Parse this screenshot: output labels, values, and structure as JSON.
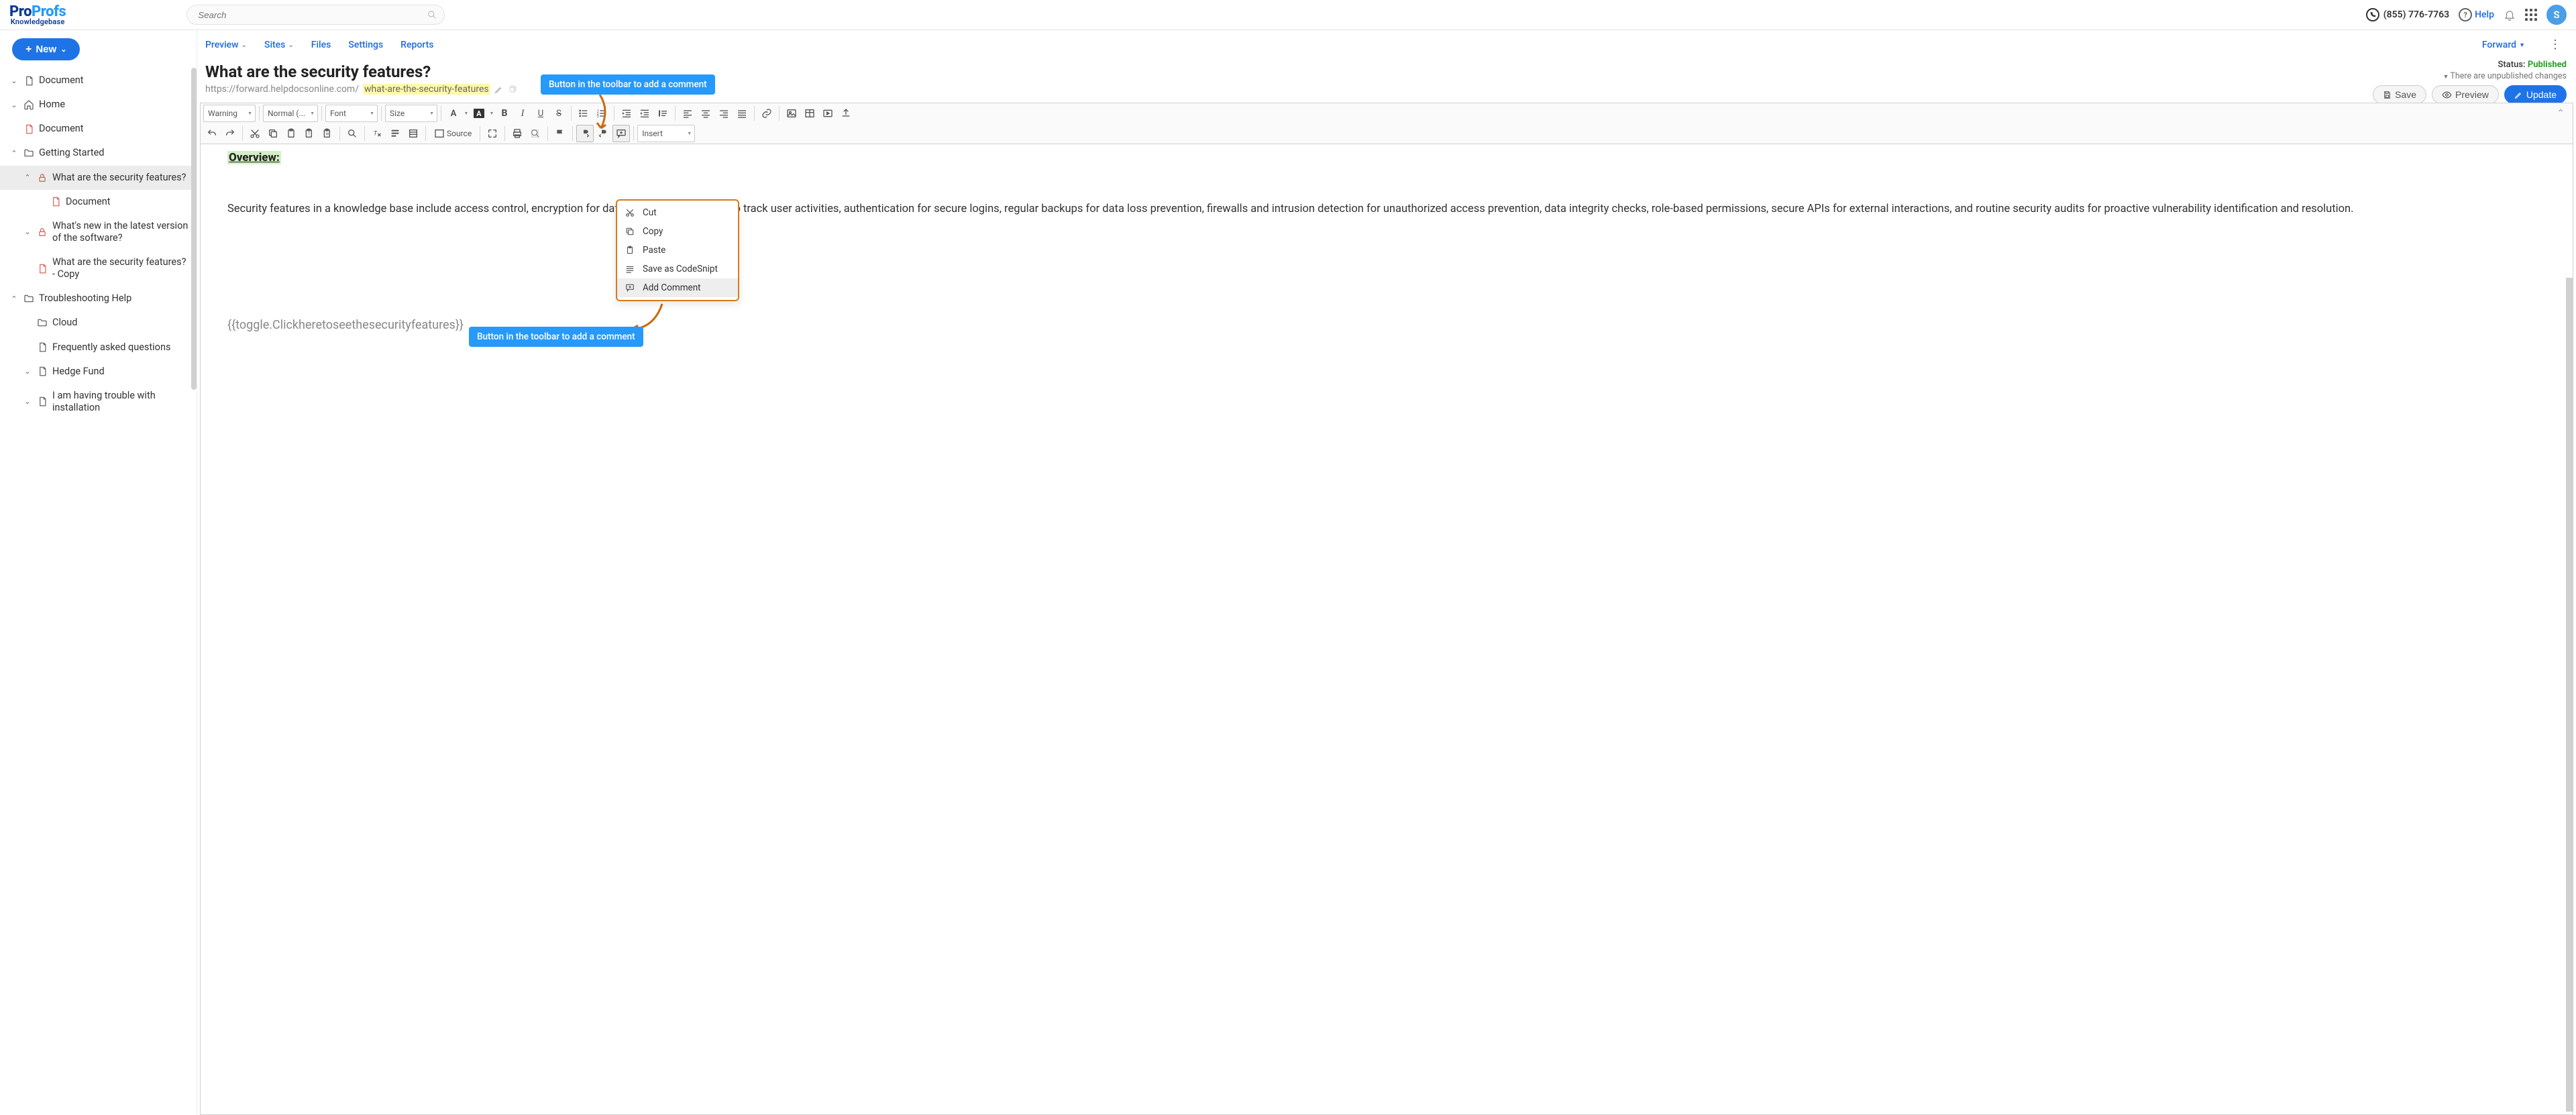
{
  "header": {
    "logo_primary": "Pro",
    "logo_secondary": "Profs",
    "logo_sub": "Knowledgebase",
    "search_placeholder": "Search",
    "phone": "(855) 776-7763",
    "help": "Help",
    "avatar_initial": "S"
  },
  "sidebar": {
    "new_label": "New",
    "items": [
      {
        "label": "Document",
        "icon": "doc",
        "level": 1,
        "toggle": "down"
      },
      {
        "label": "Home",
        "icon": "home",
        "level": 1,
        "toggle": "down"
      },
      {
        "label": "Document",
        "icon": "doc-red",
        "level": 1,
        "toggle": ""
      },
      {
        "label": "Getting Started",
        "icon": "folder",
        "level": 1,
        "toggle": "up"
      },
      {
        "label": "What are the security features?",
        "icon": "lock",
        "level": 2,
        "toggle": "up",
        "active": true
      },
      {
        "label": "Document",
        "icon": "doc-red",
        "level": 3,
        "toggle": ""
      },
      {
        "label": "What's new in the latest version of the software?",
        "icon": "lock",
        "level": 2,
        "toggle": "down"
      },
      {
        "label": "What are the security features? - Copy",
        "icon": "doc-red",
        "level": 2,
        "toggle": ""
      },
      {
        "label": "Troubleshooting Help",
        "icon": "folder",
        "level": 1,
        "toggle": "up"
      },
      {
        "label": "Cloud",
        "icon": "folder",
        "level": 2,
        "toggle": ""
      },
      {
        "label": "Frequently asked questions",
        "icon": "doc",
        "level": 2,
        "toggle": ""
      },
      {
        "label": "Hedge Fund",
        "icon": "doc",
        "level": 2,
        "toggle": "down"
      },
      {
        "label": "I am having trouble with installation",
        "icon": "doc",
        "level": 2,
        "toggle": "down"
      }
    ]
  },
  "menu": {
    "items": [
      "Preview",
      "Sites",
      "Files",
      "Settings",
      "Reports"
    ],
    "forward": "Forward"
  },
  "document": {
    "title": "What are the security features?",
    "url_prefix": "https://forward.helpdocsonline.com/",
    "url_slug": "what-are-the-security-features",
    "status_label": "Status:",
    "status_value": "Published",
    "status_sub": "There are unpublished changes",
    "save": "Save",
    "preview": "Preview",
    "update": "Update"
  },
  "callout_top": "Button in the toolbar to add a comment",
  "callout_bottom": "Button in the toolbar to add a comment",
  "toolbar": {
    "combo_warning": "Warning",
    "combo_format": "Normal (...",
    "combo_font": "Font",
    "combo_size": "Size",
    "combo_insert": "Insert",
    "source": "Source"
  },
  "editor": {
    "overview": "Overview:",
    "para_a": "Security features in a knowledge base include access control, encryption for data ",
    "sec_word": "Security",
    "para_b": " audit trails to track user activities, authentication for secure logins, regular backups for data loss prevention, firewalls and intrusion detection for unauthorized access prevention, data integrity checks, role-based permissions, secure APIs for external interactions, and routine security audits for proactive vulnerability identification and resolution.",
    "toggle": "{{toggle.Clickheretoseethesecurityfeatures}}"
  },
  "context_menu": {
    "items": [
      {
        "label": "Cut",
        "icon": "cut"
      },
      {
        "label": "Copy",
        "icon": "copy"
      },
      {
        "label": "Paste",
        "icon": "paste"
      },
      {
        "label": "Save as CodeSnipt",
        "icon": "code"
      },
      {
        "label": "Add Comment",
        "icon": "comment",
        "hover": true
      }
    ]
  }
}
